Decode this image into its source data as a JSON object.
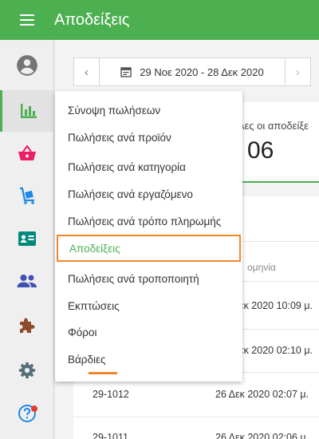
{
  "app": {
    "title": "Αποδείξεις"
  },
  "colors": {
    "accent": "#4caf50",
    "highlight": "#f0862c",
    "primary_text": "#333333"
  },
  "sidebar": {
    "items": [
      {
        "icon": "account-circle-icon"
      },
      {
        "icon": "bar-chart-icon",
        "active": true
      },
      {
        "icon": "basket-icon"
      },
      {
        "icon": "cart-icon"
      },
      {
        "icon": "id-card-icon"
      },
      {
        "icon": "people-icon"
      },
      {
        "icon": "puzzle-icon"
      },
      {
        "icon": "gear-icon"
      },
      {
        "icon": "help-icon"
      }
    ]
  },
  "date_range": {
    "label": "29 Νοε 2020 - 28 Δεκ 2020"
  },
  "summary_card": {
    "label": "λες οι αποδείξε",
    "value": "06"
  },
  "receipts": {
    "column_header": "ομηνία",
    "rows": [
      {
        "number": "",
        "date": "εκ 2020 10:09 μ."
      },
      {
        "number": "",
        "date": "εκ 2020 02:10 μ."
      },
      {
        "number": "29-1012",
        "date": "26 Δεκ 2020 02:07 μ."
      },
      {
        "number": "29-1011",
        "date": "26 Δεκ 2020 02:06 μ."
      }
    ]
  },
  "report_menu": {
    "items": [
      "Σύνοψη πωλήσεων",
      "Πωλήσεις ανά προϊόν",
      "Πωλήσεις ανά κατηγορία",
      "Πωλήσεις ανά εργαζόμενο",
      "Πωλήσεις ανά τρόπο πληρωμής",
      "Αποδείξεις",
      "Πωλήσεις ανά τροποποιητή",
      "Εκπτώσεις",
      "Φόροι",
      "Βάρδιες"
    ],
    "selected": "Αποδείξεις"
  }
}
